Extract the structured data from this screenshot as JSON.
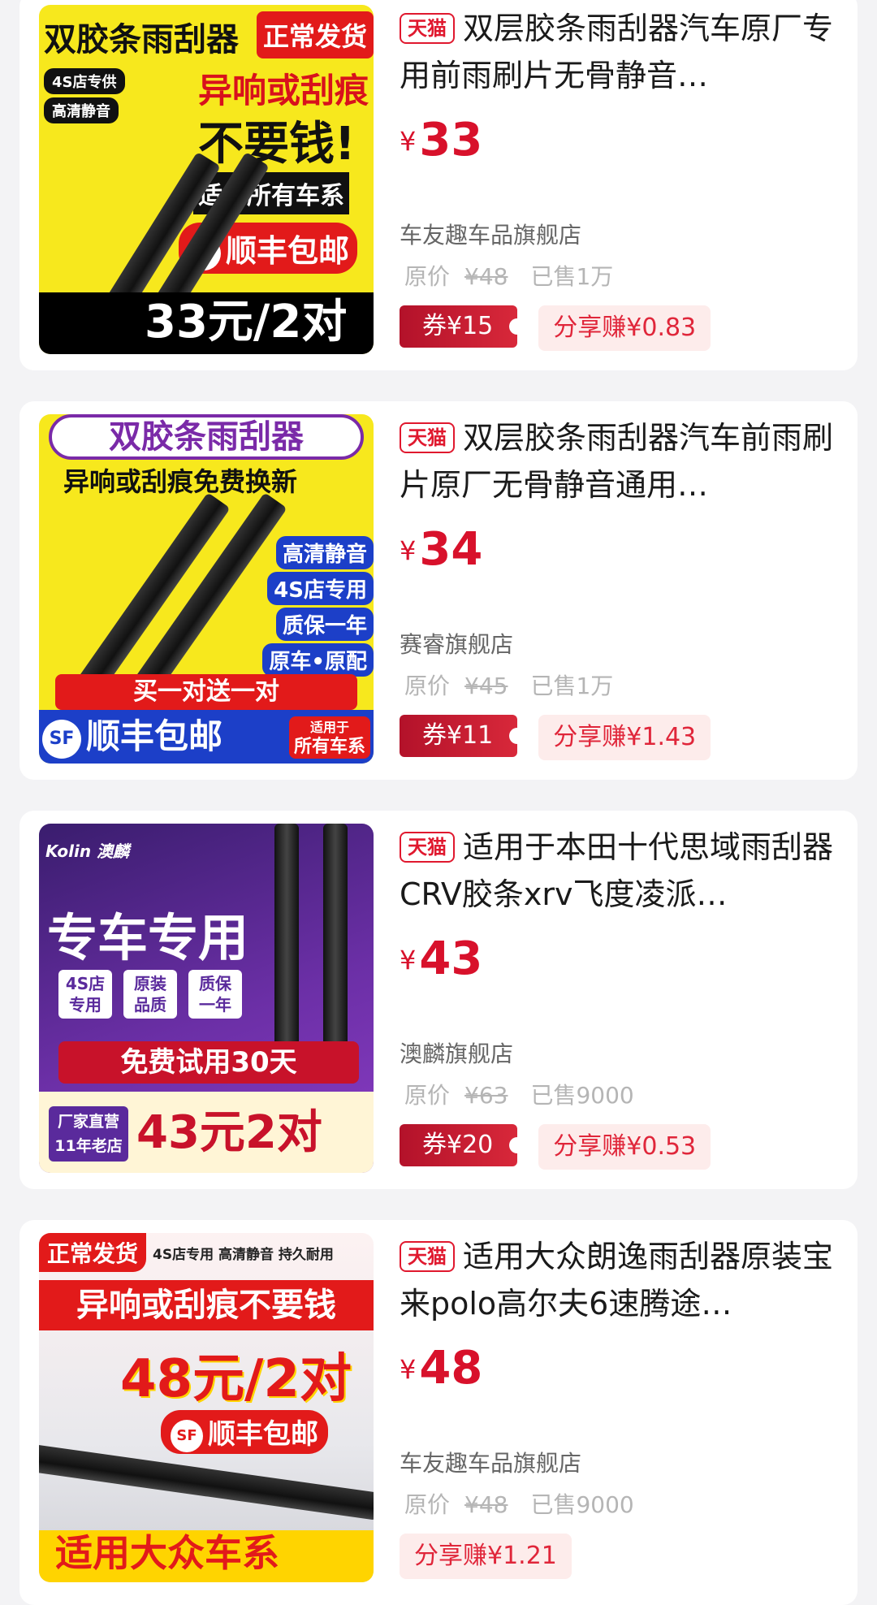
{
  "products": [
    {
      "tag": "天猫",
      "title": "双层胶条雨刮器汽车原厂专用前雨刷片无骨静音…",
      "price_symbol": "¥",
      "price": "33",
      "shop": "车友趣车品旗舰店",
      "orig_label": "原价",
      "orig_price": "¥48",
      "sold": "已售1万",
      "coupon": "券¥15",
      "share": "分享赚¥0.83",
      "image": {
        "top_left": "双胶条雨刮器",
        "top_right": "正常发货",
        "badge1": "4S店专供",
        "badge2": "高清静音",
        "line1": "异响或刮痕",
        "line2": "不要钱!",
        "line3": "适用所有车系",
        "sf": "顺丰包邮",
        "bottom": "33元/2对"
      }
    },
    {
      "tag": "天猫",
      "title": "双层胶条雨刮器汽车前雨刷片原厂无骨静音通用…",
      "price_symbol": "¥",
      "price": "34",
      "shop": "赛睿旗舰店",
      "orig_label": "原价",
      "orig_price": "¥45",
      "sold": "已售1万",
      "coupon": "券¥11",
      "share": "分享赚¥1.43",
      "image": {
        "header": "双胶条雨刮器",
        "sub": "异响或刮痕免费换新",
        "f1": "高清静音",
        "f2": "4S店专用",
        "f3": "质保一年",
        "f4": "原车•原配",
        "promo": "买一对送一对",
        "sf": "顺丰包邮",
        "fit1": "适用于",
        "fit2": "所有车系"
      }
    },
    {
      "tag": "天猫",
      "title": "适用于本田十代思域雨刮器CRV胶条xrv飞度凌派…",
      "price_symbol": "¥",
      "price": "43",
      "shop": "澳麟旗舰店",
      "orig_label": "原价",
      "orig_price": "¥63",
      "sold": "已售9000",
      "coupon": "券¥20",
      "share": "分享赚¥0.53",
      "image": {
        "brand": "Kolin 澳麟",
        "headline": "专车专用",
        "b1a": "4S店",
        "b1b": "专用",
        "b2a": "原装",
        "b2b": "品质",
        "b3a": "质保",
        "b3b": "一年",
        "trial": "免费试用30天",
        "factory1": "厂家直营",
        "factory2": "11年老店",
        "deal": "43元2对"
      }
    },
    {
      "tag": "天猫",
      "title": "适用大众朗逸雨刮器原装宝来polo高尔夫6速腾途…",
      "price_symbol": "¥",
      "price": "48",
      "shop": "车友趣车品旗舰店",
      "orig_label": "原价",
      "orig_price": "¥48",
      "sold": "已售9000",
      "coupon": "",
      "share": "分享赚¥1.21",
      "image": {
        "ship": "正常发货",
        "tags": "4S店专用 高清静音 持久耐用",
        "line1": "异响或刮痕不要钱",
        "deal": "48元/2对",
        "sf": "顺丰包邮",
        "bottom": "适用大众车系"
      }
    }
  ]
}
